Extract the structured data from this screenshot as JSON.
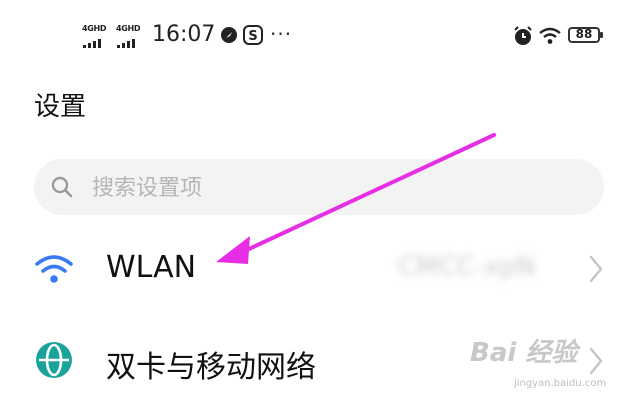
{
  "status_bar": {
    "sim1_label": "4GHD",
    "sim2_label": "4GHD",
    "time": "16:07",
    "more_dots": "···",
    "battery": "88",
    "icons": [
      "signal-icon",
      "signal-icon",
      "location-icon",
      "app-s-icon",
      "alarm-icon",
      "wifi-icon",
      "battery-icon"
    ]
  },
  "page": {
    "title": "设置"
  },
  "search": {
    "placeholder": "搜索设置项",
    "value": ""
  },
  "list": {
    "items": [
      {
        "label": "WLAN",
        "value": "CMCC-xpN",
        "icon": "wifi-icon",
        "has_chevron": true
      },
      {
        "label": "双卡与移动网络",
        "icon": "globe-icon",
        "has_chevron": true
      }
    ]
  },
  "annotation": {
    "arrow_color": "#e62ee6"
  },
  "watermark": {
    "text": "Bai 经验",
    "url": "jingyan.baidu.com"
  },
  "colors": {
    "accent_blue": "#3a7bf5",
    "globe_teal": "#1aa39a"
  }
}
